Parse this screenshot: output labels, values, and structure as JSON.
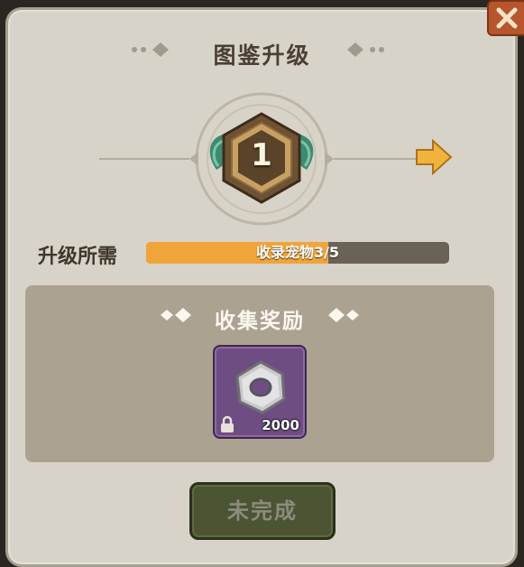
{
  "dialog": {
    "title": "图鉴升级",
    "level": "1",
    "requirement_label": "升级所需",
    "progress_text": "收录宠物3/5",
    "progress_fraction": 0.6
  },
  "reward": {
    "title": "收集奖励",
    "item_icon": "gear-nut-icon",
    "item_count": "2000"
  },
  "status_button": {
    "label": "未完成"
  },
  "colors": {
    "panel": "#d8d3c8",
    "progress_fill": "#f0a43a",
    "item_slot": "#6e4d82",
    "button": "#4b5433",
    "arrow": "#f2b33d"
  }
}
